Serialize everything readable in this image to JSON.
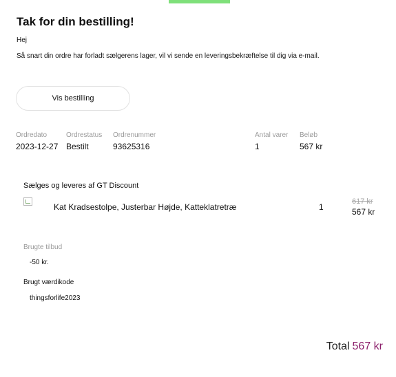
{
  "header": {
    "title": "Tak for din bestilling!",
    "greeting": "Hej",
    "message": "Så snart din ordre har forladt sælgerens lager, vil vi sende en leveringsbekræftelse til dig via e-mail."
  },
  "actions": {
    "view_order_label": "Vis bestilling"
  },
  "order_summary": {
    "headers": [
      "Ordredato",
      "Ordrestatus",
      "Ordrenummer",
      "Antal varer",
      "Beløb"
    ],
    "values": [
      "2023-12-27",
      "Bestilt",
      "93625316",
      "1",
      "567 kr"
    ]
  },
  "seller": {
    "label": "Sælges og leveres af GT Discount"
  },
  "item": {
    "name": "Kat Kradsestolpe, Justerbar Højde, Katteklatretræ",
    "quantity": "1",
    "old_price": "617 kr",
    "price": "567 kr"
  },
  "offers": {
    "label": "Brugte tilbud",
    "value": "-50 kr."
  },
  "voucher": {
    "label": "Brugt værdikode",
    "value": "thingsforlife2023"
  },
  "total": {
    "label": "Total",
    "amount": "567 kr"
  },
  "colors": {
    "accent_bar": "#7fe07a",
    "total_amount": "#8b1f6b"
  }
}
